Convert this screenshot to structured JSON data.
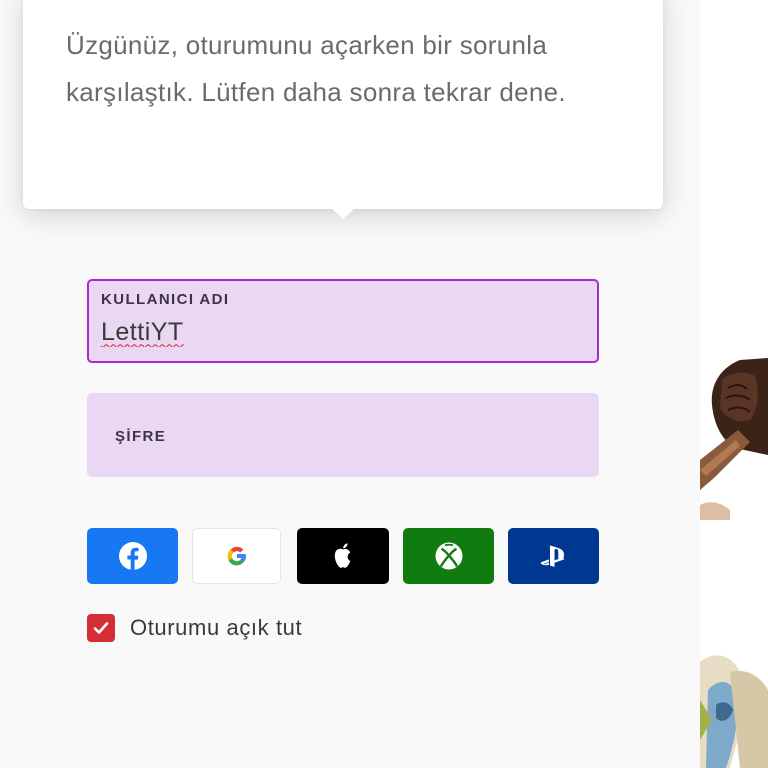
{
  "error_popover": {
    "message": "Üzgünüz, oturumunu açarken bir sorunla karşılaştık. Lütfen daha sonra tekrar dene."
  },
  "username_field": {
    "label": "KULLANICI ADI",
    "value": "LettiYT"
  },
  "password_field": {
    "label": "ŞİFRE",
    "value": ""
  },
  "social_buttons": [
    {
      "provider": "facebook",
      "icon": "facebook-icon",
      "color": "#1877f2"
    },
    {
      "provider": "google",
      "icon": "google-icon",
      "color": "#ffffff"
    },
    {
      "provider": "apple",
      "icon": "apple-icon",
      "color": "#000000"
    },
    {
      "provider": "xbox",
      "icon": "xbox-icon",
      "color": "#107c10"
    },
    {
      "provider": "playstation",
      "icon": "playstation-icon",
      "color": "#003791"
    }
  ],
  "remember_me": {
    "label": "Oturumu açık tut",
    "checked": true
  },
  "colors": {
    "field_background": "#ead7f4",
    "focus_border": "#a52ad0",
    "checkbox": "#d42f36"
  }
}
